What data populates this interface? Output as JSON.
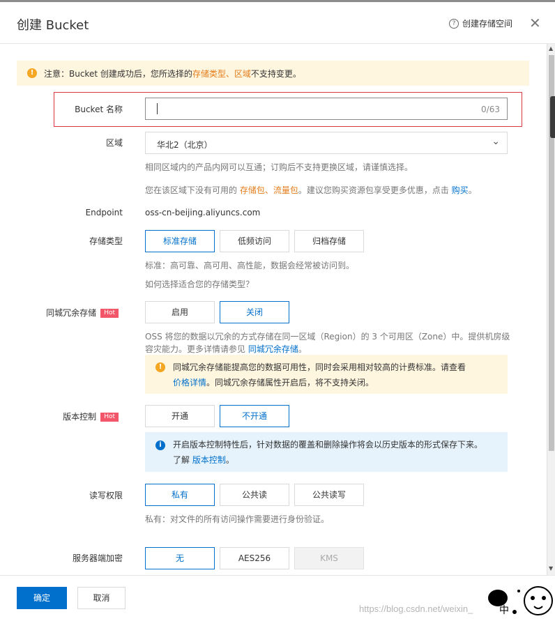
{
  "dialog": {
    "title": "创建 Bucket",
    "help_link": "创建存储空间",
    "help_icon": "question-circle-icon",
    "close_icon": "close-icon"
  },
  "notice": {
    "prefix": "注意：Bucket 创建成功后，您所选择的 ",
    "highlight": "存储类型、区域",
    "suffix": " 不支持变更。"
  },
  "bucket_name": {
    "label": "Bucket 名称",
    "value": "",
    "counter": "0/63"
  },
  "region": {
    "label": "区域",
    "selected": "华北2（北京）",
    "hint1": "相同区域内的产品内网可以互通；订购后不支持更换区域，请谨慎选择。",
    "hint2_prefix": "您在该区域下没有可用的 ",
    "hint2_highlight": "存储包、流量包",
    "hint2_mid": "。建议您购买资源包享受更多优惠，点击 ",
    "hint2_link": "购买",
    "hint2_suffix": "。"
  },
  "endpoint": {
    "label": "Endpoint",
    "value": "oss-cn-beijing.aliyuncs.com"
  },
  "storage_class": {
    "label": "存储类型",
    "options": [
      "标准存储",
      "低频访问",
      "归档存储"
    ],
    "selected": "标准存储",
    "hint": "标准：高可靠、高可用、高性能，数据会经常被访问到。",
    "link": "如何选择适合您的存储类型？"
  },
  "zrs": {
    "label": "同城冗余存储",
    "badge": "Hot",
    "options": [
      "启用",
      "关闭"
    ],
    "selected": "关闭",
    "desc_line1": "OSS 将您的数据以冗余的方式存储在同一区域（Region）的 3 个可用区（Zone）中。提供机房级",
    "desc_line2_prefix": "容灾能力。更多详情请参见 ",
    "desc_line2_link": "同城冗余存储",
    "desc_line2_suffix": "。",
    "tip_line1": "同城冗余存储能提高您的数据可用性，同时会采用相对较高的计费标准。请查看",
    "tip_link": "价格详情",
    "tip_line2": "。同城冗余存储属性开启后，将不支持关闭。"
  },
  "versioning": {
    "label": "版本控制",
    "badge": "Hot",
    "options": [
      "开通",
      "不开通"
    ],
    "selected": "不开通",
    "tip_line1": "开启版本控制特性后，针对数据的覆盖和删除操作将会以历史版本的形式保存下来。",
    "tip_prefix": "了解 ",
    "tip_link": "版本控制",
    "tip_suffix": "。"
  },
  "acl": {
    "label": "读写权限",
    "options": [
      "私有",
      "公共读",
      "公共读写"
    ],
    "selected": "私有",
    "hint": "私有：对文件的所有访问操作需要进行身份验证。"
  },
  "encryption": {
    "label": "服务器端加密",
    "options": [
      "无",
      "AES256",
      "KMS"
    ],
    "selected": "无",
    "disabled": "KMS"
  },
  "footer": {
    "confirm": "确定",
    "cancel": "取消",
    "watermark": "https://blog.csdn.net/weixin_",
    "cat_text": "中"
  },
  "colors": {
    "primary": "#0070cc",
    "warning": "#e47d1b",
    "error_border": "#d9363e",
    "hot_badge": "#f25668"
  }
}
